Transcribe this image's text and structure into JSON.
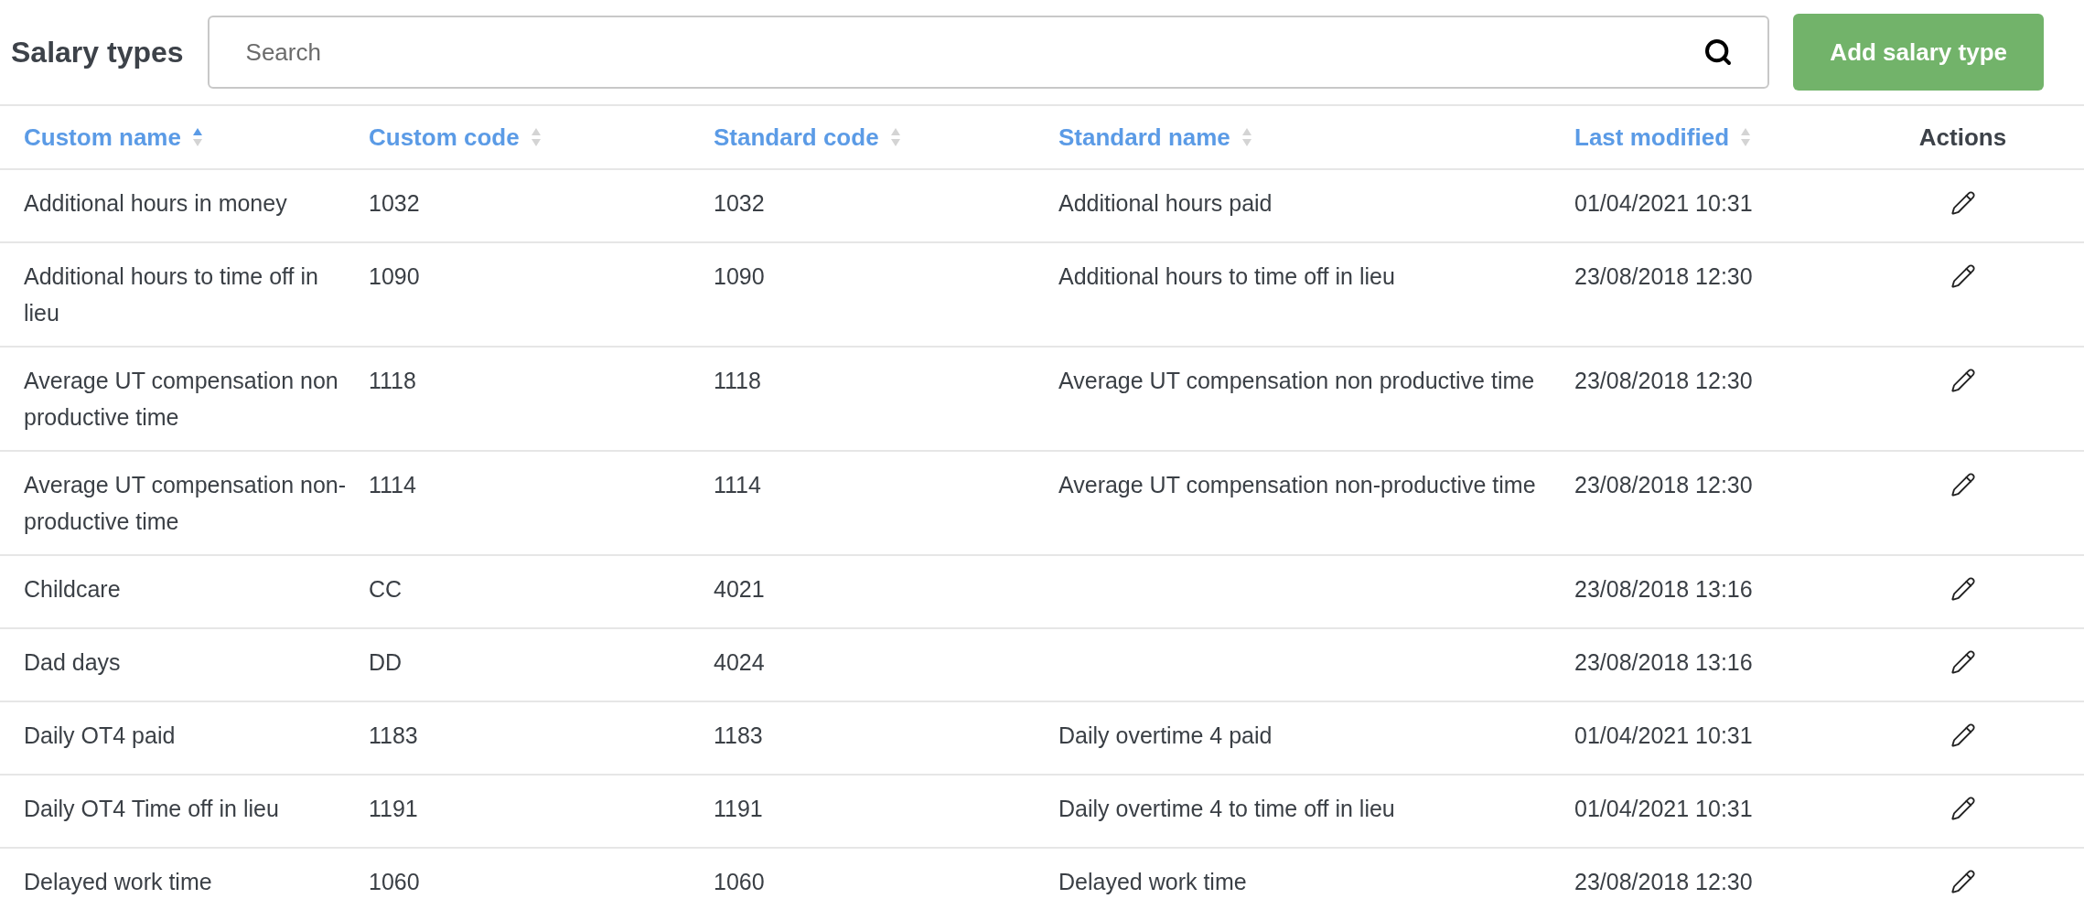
{
  "page_title": "Salary types",
  "search": {
    "placeholder": "Search"
  },
  "add_button": "Add salary type",
  "columns": [
    {
      "label": "Custom name",
      "kind": "sortable",
      "selected": true
    },
    {
      "label": "Custom code",
      "kind": "sortable",
      "selected": false
    },
    {
      "label": "Standard code",
      "kind": "sortable",
      "selected": false
    },
    {
      "label": "Standard name",
      "kind": "sortable",
      "selected": false
    },
    {
      "label": "Last modified",
      "kind": "sortable",
      "selected": false
    },
    {
      "label": "Actions",
      "kind": "plain"
    }
  ],
  "rows": [
    {
      "custom_name": "Additional hours in money",
      "custom_code": "1032",
      "standard_code": "1032",
      "standard_name": "Additional hours paid",
      "last_modified": "01/04/2021 10:31"
    },
    {
      "custom_name": "Additional hours to time off in lieu",
      "custom_code": "1090",
      "standard_code": "1090",
      "standard_name": "Additional hours to time off in lieu",
      "last_modified": "23/08/2018 12:30"
    },
    {
      "custom_name": "Average UT compensation non productive time",
      "custom_code": "1118",
      "standard_code": "1118",
      "standard_name": "Average UT compensation non productive time",
      "last_modified": "23/08/2018 12:30"
    },
    {
      "custom_name": "Average UT compensation non-productive time",
      "custom_code": "1114",
      "standard_code": "1114",
      "standard_name": "Average UT compensation non-productive time",
      "last_modified": "23/08/2018 12:30"
    },
    {
      "custom_name": "Childcare",
      "custom_code": "CC",
      "standard_code": "4021",
      "last_modified": "23/08/2018 13:16"
    },
    {
      "custom_name": "Dad days",
      "custom_code": "DD",
      "standard_code": "4024",
      "last_modified": "23/08/2018 13:16"
    },
    {
      "custom_name": "Daily OT4 paid",
      "custom_code": "1183",
      "standard_code": "1183",
      "standard_name": "Daily overtime 4 paid",
      "last_modified": "01/04/2021 10:31"
    },
    {
      "custom_name": "Daily OT4 Time off in lieu",
      "custom_code": "1191",
      "standard_code": "1191",
      "standard_name": "Daily overtime 4 to time off in lieu",
      "last_modified": "01/04/2021 10:31"
    },
    {
      "custom_name": "Delayed work time",
      "custom_code": "1060",
      "standard_code": "1060",
      "standard_name": "Delayed work time",
      "last_modified": "23/08/2018 12:30"
    }
  ]
}
